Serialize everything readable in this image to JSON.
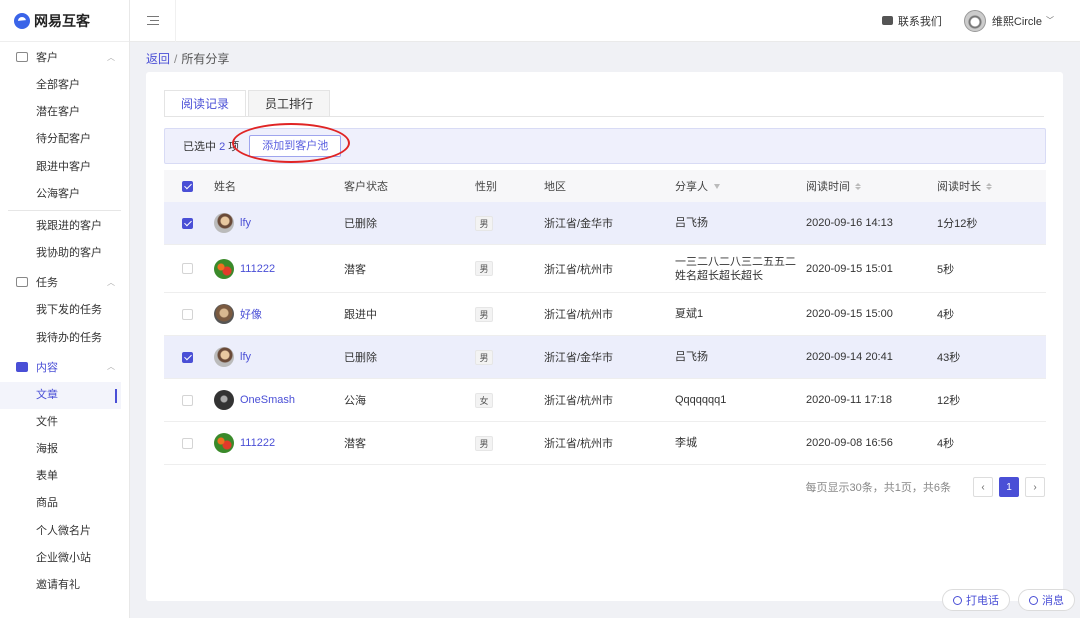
{
  "brand": {
    "name": "网易互客"
  },
  "sidebar": {
    "groups": [
      {
        "label": "客户",
        "icon": "contacts-icon",
        "items": [
          "全部客户",
          "潜在客户",
          "待分配客户",
          "跟进中客户",
          "公海客户"
        ],
        "items2": [
          "我跟进的客户",
          "我协助的客户"
        ]
      },
      {
        "label": "任务",
        "icon": "task-icon",
        "items": [
          "我下发的任务",
          "我待办的任务"
        ]
      },
      {
        "label": "内容",
        "icon": "document-icon",
        "items": [
          "文章",
          "文件",
          "海报",
          "表单",
          "商品",
          "个人微名片",
          "企业微小站",
          "邀请有礼"
        ]
      }
    ]
  },
  "header": {
    "contact": "联系我们",
    "user": "维熙Circle"
  },
  "breadcrumb": {
    "back": "返回",
    "sep": "/",
    "current": "所有分享"
  },
  "tabs": [
    "阅读记录",
    "员工排行"
  ],
  "selection": {
    "prefix": "已选中",
    "count": "2",
    "suffix": "项",
    "add_button": "添加到客户池"
  },
  "table": {
    "columns": [
      "姓名",
      "客户状态",
      "性别",
      "地区",
      "分享人",
      "阅读时间",
      "阅读时长"
    ],
    "rows": [
      {
        "checked": true,
        "name": "lfy",
        "status": "已删除",
        "gender": "男",
        "region": "浙江省/金华市",
        "sharer": [
          "吕飞扬"
        ],
        "time": "2020-09-16 14:13",
        "duration": "1分12秒"
      },
      {
        "checked": false,
        "name": "111222",
        "status": "潜客",
        "gender": "男",
        "region": "浙江省/杭州市",
        "sharer": [
          "一三二八二八三二五五二",
          "姓名超长超长超长"
        ],
        "time": "2020-09-15 15:01",
        "duration": "5秒"
      },
      {
        "checked": false,
        "name": "好像",
        "status": "跟进中",
        "gender": "男",
        "region": "浙江省/杭州市",
        "sharer": [
          "夏斌1"
        ],
        "time": "2020-09-15 15:00",
        "duration": "4秒"
      },
      {
        "checked": true,
        "name": "lfy",
        "status": "已删除",
        "gender": "男",
        "region": "浙江省/金华市",
        "sharer": [
          "吕飞扬"
        ],
        "time": "2020-09-14 20:41",
        "duration": "43秒"
      },
      {
        "checked": false,
        "name": "OneSmash",
        "status": "公海",
        "gender": "女",
        "region": "浙江省/杭州市",
        "sharer": [
          "Qqqqqqq1"
        ],
        "time": "2020-09-11 17:18",
        "duration": "12秒"
      },
      {
        "checked": false,
        "name": "111222",
        "status": "潜客",
        "gender": "男",
        "region": "浙江省/杭州市",
        "sharer": [
          "李城"
        ],
        "time": "2020-09-08 16:56",
        "duration": "4秒"
      }
    ]
  },
  "pagination": {
    "summary": "每页显示30条，共1页，共6条",
    "prev": "‹",
    "current": "1",
    "next": "›"
  },
  "floating": {
    "call": "打电话",
    "message": "消息"
  },
  "colors": {
    "accent": "#4a4fd6",
    "highlight": "#e02424"
  }
}
